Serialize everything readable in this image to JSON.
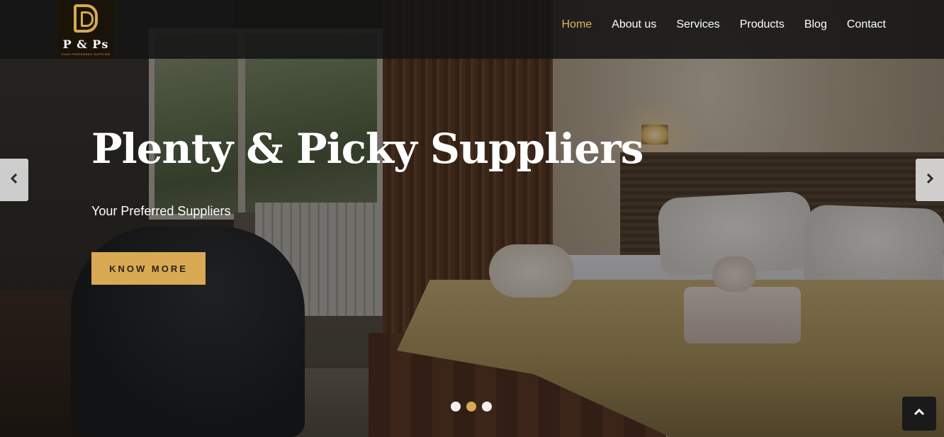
{
  "brand": {
    "logo_text": "P & Ps",
    "logo_tagline": "YOUR PREFERRED SUPPLIER",
    "accent_color": "#d9a954"
  },
  "nav": {
    "items": [
      {
        "label": "Home",
        "active": true
      },
      {
        "label": "About us",
        "active": false
      },
      {
        "label": "Services",
        "active": false
      },
      {
        "label": "Products",
        "active": false
      },
      {
        "label": "Blog",
        "active": false
      },
      {
        "label": "Contact",
        "active": false
      }
    ]
  },
  "hero": {
    "title": "Plenty & Picky Suppliers",
    "subtitle": "Your Preferred Suppliers",
    "cta_label": "KNOW MORE"
  },
  "carousel": {
    "prev_icon": "chevron-left-icon",
    "next_icon": "chevron-right-icon",
    "slide_count": 3,
    "active_slide": 2
  },
  "scroll_top": {
    "icon": "chevron-up-icon"
  }
}
